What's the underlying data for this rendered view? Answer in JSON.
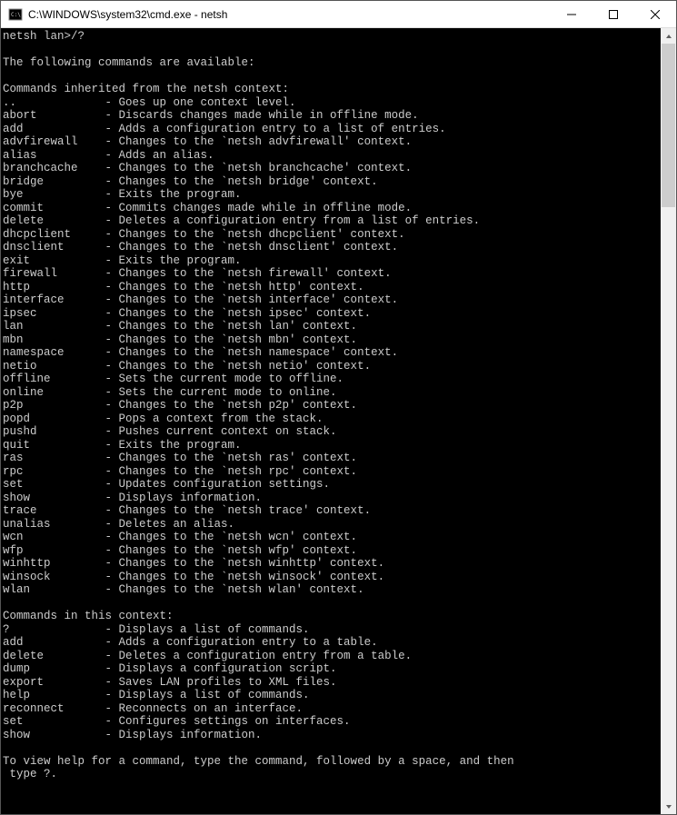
{
  "window": {
    "title": "C:\\WINDOWS\\system32\\cmd.exe - netsh"
  },
  "prompt": "netsh lan>/?",
  "intro": "The following commands are available:",
  "section1_header": "Commands inherited from the netsh context:",
  "inherited": [
    {
      "cmd": "..",
      "desc": "- Goes up one context level."
    },
    {
      "cmd": "abort",
      "desc": "- Discards changes made while in offline mode."
    },
    {
      "cmd": "add",
      "desc": "- Adds a configuration entry to a list of entries."
    },
    {
      "cmd": "advfirewall",
      "desc": "- Changes to the `netsh advfirewall' context."
    },
    {
      "cmd": "alias",
      "desc": "- Adds an alias."
    },
    {
      "cmd": "branchcache",
      "desc": "- Changes to the `netsh branchcache' context."
    },
    {
      "cmd": "bridge",
      "desc": "- Changes to the `netsh bridge' context."
    },
    {
      "cmd": "bye",
      "desc": "- Exits the program."
    },
    {
      "cmd": "commit",
      "desc": "- Commits changes made while in offline mode."
    },
    {
      "cmd": "delete",
      "desc": "- Deletes a configuration entry from a list of entries."
    },
    {
      "cmd": "dhcpclient",
      "desc": "- Changes to the `netsh dhcpclient' context."
    },
    {
      "cmd": "dnsclient",
      "desc": "- Changes to the `netsh dnsclient' context."
    },
    {
      "cmd": "exit",
      "desc": "- Exits the program."
    },
    {
      "cmd": "firewall",
      "desc": "- Changes to the `netsh firewall' context."
    },
    {
      "cmd": "http",
      "desc": "- Changes to the `netsh http' context."
    },
    {
      "cmd": "interface",
      "desc": "- Changes to the `netsh interface' context."
    },
    {
      "cmd": "ipsec",
      "desc": "- Changes to the `netsh ipsec' context."
    },
    {
      "cmd": "lan",
      "desc": "- Changes to the `netsh lan' context."
    },
    {
      "cmd": "mbn",
      "desc": "- Changes to the `netsh mbn' context."
    },
    {
      "cmd": "namespace",
      "desc": "- Changes to the `netsh namespace' context."
    },
    {
      "cmd": "netio",
      "desc": "- Changes to the `netsh netio' context."
    },
    {
      "cmd": "offline",
      "desc": "- Sets the current mode to offline."
    },
    {
      "cmd": "online",
      "desc": "- Sets the current mode to online."
    },
    {
      "cmd": "p2p",
      "desc": "- Changes to the `netsh p2p' context."
    },
    {
      "cmd": "popd",
      "desc": "- Pops a context from the stack."
    },
    {
      "cmd": "pushd",
      "desc": "- Pushes current context on stack."
    },
    {
      "cmd": "quit",
      "desc": "- Exits the program."
    },
    {
      "cmd": "ras",
      "desc": "- Changes to the `netsh ras' context."
    },
    {
      "cmd": "rpc",
      "desc": "- Changes to the `netsh rpc' context."
    },
    {
      "cmd": "set",
      "desc": "- Updates configuration settings."
    },
    {
      "cmd": "show",
      "desc": "- Displays information."
    },
    {
      "cmd": "trace",
      "desc": "- Changes to the `netsh trace' context."
    },
    {
      "cmd": "unalias",
      "desc": "- Deletes an alias."
    },
    {
      "cmd": "wcn",
      "desc": "- Changes to the `netsh wcn' context."
    },
    {
      "cmd": "wfp",
      "desc": "- Changes to the `netsh wfp' context."
    },
    {
      "cmd": "winhttp",
      "desc": "- Changes to the `netsh winhttp' context."
    },
    {
      "cmd": "winsock",
      "desc": "- Changes to the `netsh winsock' context."
    },
    {
      "cmd": "wlan",
      "desc": "- Changes to the `netsh wlan' context."
    }
  ],
  "section2_header": "Commands in this context:",
  "context": [
    {
      "cmd": "?",
      "desc": "- Displays a list of commands."
    },
    {
      "cmd": "add",
      "desc": "- Adds a configuration entry to a table."
    },
    {
      "cmd": "delete",
      "desc": "- Deletes a configuration entry from a table."
    },
    {
      "cmd": "dump",
      "desc": "- Displays a configuration script."
    },
    {
      "cmd": "export",
      "desc": "- Saves LAN profiles to XML files."
    },
    {
      "cmd": "help",
      "desc": "- Displays a list of commands."
    },
    {
      "cmd": "reconnect",
      "desc": "- Reconnects on an interface."
    },
    {
      "cmd": "set",
      "desc": "- Configures settings on interfaces."
    },
    {
      "cmd": "show",
      "desc": "- Displays information."
    }
  ],
  "footer1": "To view help for a command, type the command, followed by a space, and then",
  "footer2": " type ?."
}
